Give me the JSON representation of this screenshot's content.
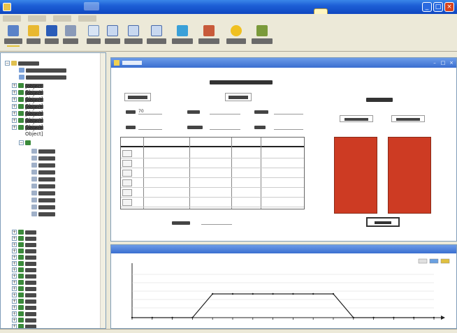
{
  "window": {
    "title": "",
    "controls": [
      "minimize",
      "maximize",
      "close"
    ]
  },
  "menu": {
    "items": [
      "",
      "",
      "",
      ""
    ]
  },
  "toolbar": {
    "items": [
      {
        "icon": "back-icon",
        "label": ""
      },
      {
        "icon": "folder-icon",
        "label": ""
      },
      {
        "icon": "save-icon",
        "label": ""
      },
      {
        "icon": "print-icon",
        "label": ""
      },
      {
        "icon": "document-icon",
        "label": ""
      },
      {
        "icon": "chart-icon",
        "label": ""
      },
      {
        "icon": "chart-icon",
        "label": ""
      },
      {
        "icon": "chart-icon",
        "label": ""
      },
      {
        "icon": "refresh-icon",
        "label": ""
      },
      {
        "icon": "package-icon",
        "label": ""
      },
      {
        "icon": "lightbulb-icon",
        "label": ""
      },
      {
        "icon": "vehicle-icon",
        "label": ""
      }
    ]
  },
  "tree": {
    "root_label": "",
    "nodes": [
      {
        "label": "",
        "level": 1
      },
      {
        "label": "",
        "level": 1
      },
      {
        "label": "",
        "level": 1
      },
      {
        "label": "",
        "level": 1
      },
      {
        "label": "",
        "level": 1
      },
      {
        "label": "",
        "level": 1
      },
      {
        "label": "",
        "level": 1
      }
    ],
    "expanded_children": [
      "",
      "",
      "",
      "",
      "",
      "",
      "",
      "",
      "",
      ""
    ],
    "lower_nodes": [
      "",
      "",
      "",
      "",
      "",
      "",
      "",
      "",
      "",
      "",
      "",
      "",
      "",
      "",
      "",
      ""
    ]
  },
  "form": {
    "heading": "",
    "section_left": "",
    "section_mid": "",
    "section_right": "",
    "fields_row1": [
      {
        "label": "",
        "value": "70"
      },
      {
        "label": "",
        "value": ""
      },
      {
        "label": "",
        "value": ""
      }
    ],
    "fields_row2": [
      {
        "label": "",
        "value": ""
      },
      {
        "label": "",
        "value": ""
      },
      {
        "label": "",
        "value": ""
      }
    ],
    "grid": {
      "columns": [
        "",
        "",
        "",
        ""
      ],
      "rows": [
        [
          "",
          "",
          "",
          ""
        ],
        [
          "",
          "",
          "",
          ""
        ],
        [
          "",
          "",
          "",
          ""
        ],
        [
          "",
          "",
          "",
          ""
        ],
        [
          "",
          "",
          "",
          ""
        ],
        [
          "",
          "",
          "",
          ""
        ]
      ]
    },
    "footer_label": "",
    "footer_value": "",
    "bars": [
      {
        "label": "",
        "fill": 1.0
      },
      {
        "label": "",
        "fill": 1.0
      }
    ],
    "ok_button": ""
  },
  "chart_data": {
    "type": "line",
    "title": "",
    "xlabel": "",
    "ylabel": "",
    "series": [
      {
        "values": [
          0,
          0,
          0,
          0,
          1,
          1,
          1,
          1,
          1,
          1,
          1,
          0,
          0,
          0,
          0,
          0
        ]
      }
    ],
    "legend": ""
  },
  "colors": {
    "title_blue": "#1d5fd6",
    "bar_red": "#cd3b23",
    "chrome": "#ece9d8"
  }
}
